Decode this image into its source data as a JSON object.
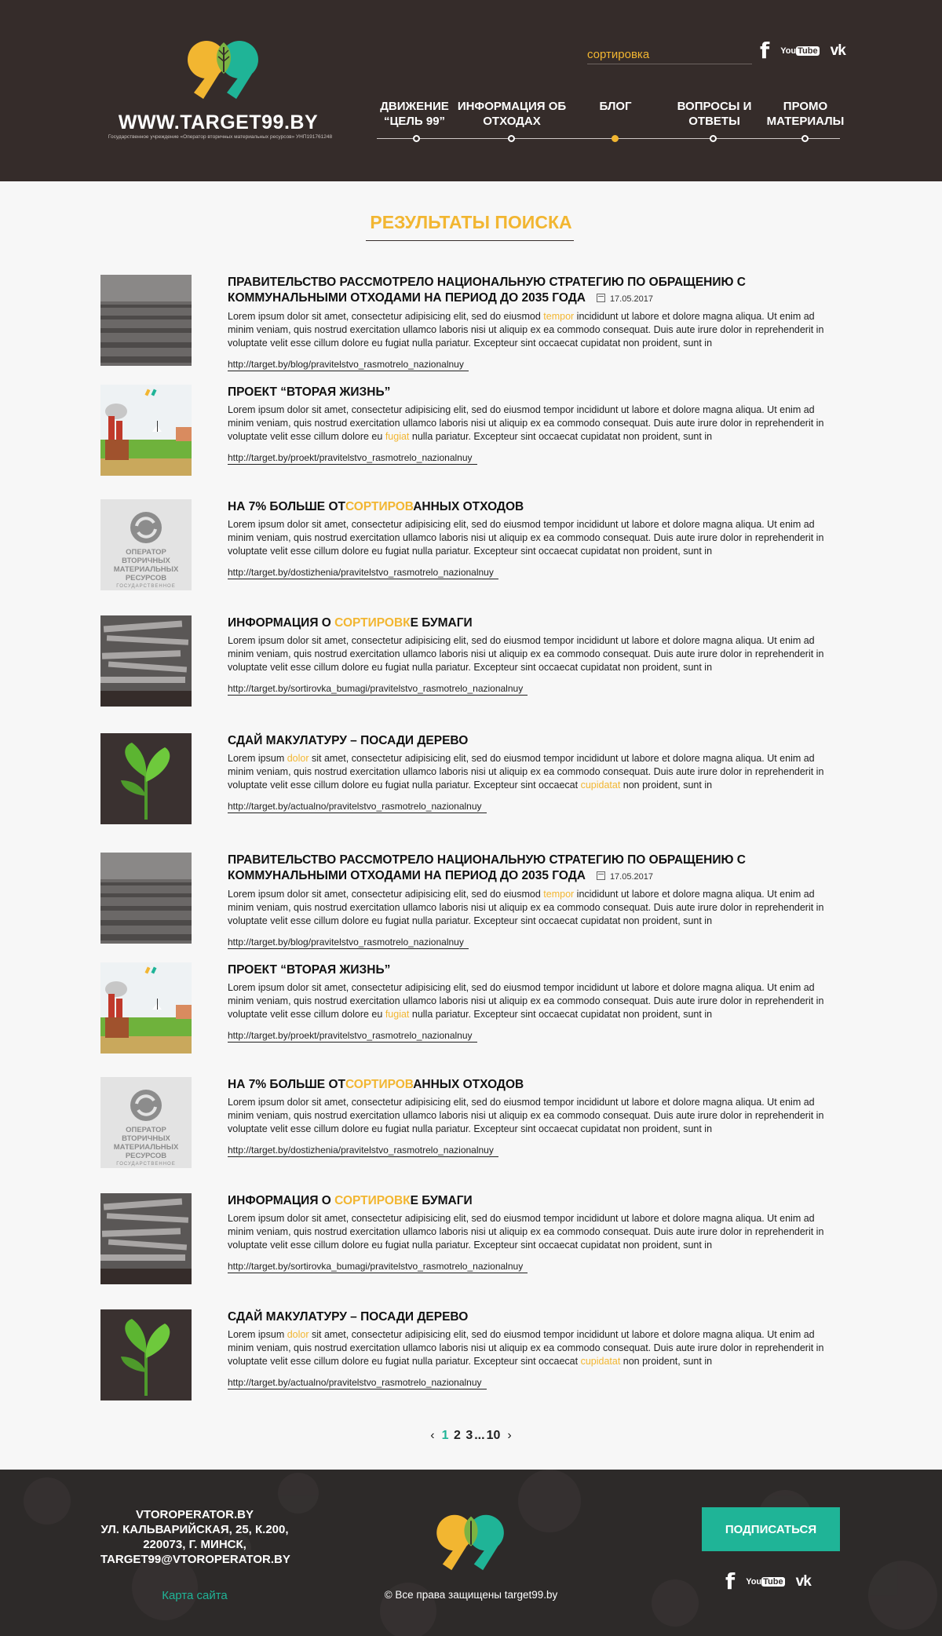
{
  "colors": {
    "header_bg": "#352c2a",
    "accent_yellow": "#f2b631",
    "accent_green": "#1fb497"
  },
  "header": {
    "brand": "WWW.TARGET99.BY",
    "brand_sub": "Государственное учреждение «Оператор вторичных материальных ресурсов» УНП191761248",
    "search_placeholder": "сортировка",
    "social": [
      "facebook-icon",
      "youtube-icon",
      "vk-icon"
    ],
    "youtube_top": "You",
    "youtube_bottom": "Tube",
    "vk": "vk",
    "facebook": "f",
    "nav": [
      {
        "line1": "ДВИЖЕНИЕ",
        "line2": "“ЦЕЛЬ 99”"
      },
      {
        "line1": "ИНФОРМАЦИЯ ОБ",
        "line2": "ОТХОДАХ"
      },
      {
        "line1": "БЛОГ",
        "line2": ""
      },
      {
        "line1": "ВОПРОСЫ И",
        "line2": "ОТВЕТЫ"
      },
      {
        "line1": "ПРОМО",
        "line2": "МАТЕРИАЛЫ"
      }
    ],
    "nav_active": 2
  },
  "main": {
    "title": "РЕЗУЛЬТАТЫ ПОИСКА",
    "results": [
      {
        "thumb": "field",
        "title_pre": "ПРАВИТЕЛЬСТВО РАССМОТРЕЛО НАЦИОНАЛЬНУЮ СТРАТЕГИЮ ПО ОБРАЩЕНИЮ С КОММУНАЛЬНЫМИ ОТХОДАМИ НА ПЕРИОД  ДО 2035 ГОДА",
        "title_hl": "",
        "title_post": "",
        "date": "17.05.2017",
        "text_a": "Lorem ipsum dolor sit amet, consectetur adipisicing elit, sed do eiusmod ",
        "text_hl": "tempor",
        "text_b": " incididunt ut labore et dolore magna aliqua. Ut enim ad minim veniam, quis nostrud exercitation ullamco laboris nisi ut aliquip ex ea commodo consequat. Duis aute irure dolor in reprehenderit in voluptate velit esse cillum dolore eu fugiat nulla pariatur. Excepteur sint occaecat cupidatat non proident, sunt in",
        "text_hl2": "",
        "text_c": "",
        "url": "http://target.by/blog/pravitelstvo_rasmotrelo_nazionalnuy"
      },
      {
        "thumb": "factory",
        "title_pre": "ПРОЕКТ “ВТОРАЯ ЖИЗНЬ”",
        "title_hl": "",
        "title_post": "",
        "date": "",
        "text_a": "Lorem ipsum dolor sit amet, consectetur adipisicing elit, sed do eiusmod tempor incididunt ut labore et dolore magna aliqua. Ut enim ad minim veniam, quis nostrud exercitation ullamco laboris nisi ut aliquip ex ea commodo consequat. Duis aute irure dolor in reprehenderit in voluptate velit esse cillum dolore eu ",
        "text_hl": "fugiat",
        "text_b": " nulla pariatur. Excepteur sint occaecat cupidatat non proident, sunt in",
        "text_hl2": "",
        "text_c": "",
        "url": "http://target.by/proekt/pravitelstvo_rasmotrelo_nazionalnuy"
      },
      {
        "thumb": "operator",
        "title_pre": "НА 7% БОЛЬШЕ ОТ",
        "title_hl": "СОРТИРОВ",
        "title_post": "АННЫХ ОТХОДОВ",
        "date": "",
        "text_a": "Lorem ipsum dolor sit amet, consectetur adipisicing elit, sed do eiusmod tempor incididunt ut labore et dolore magna aliqua. Ut enim ad minim veniam, quis nostrud exercitation ullamco laboris nisi ut aliquip ex ea commodo consequat. Duis aute irure dolor in reprehenderit in voluptate velit esse cillum dolore eu fugiat nulla pariatur. Excepteur sint occaecat cupidatat non proident, sunt in",
        "text_hl": "",
        "text_b": "",
        "text_hl2": "",
        "text_c": "",
        "url": "http://target.by/dostizhenia/pravitelstvo_rasmotrelo_nazionalnuy"
      },
      {
        "thumb": "paper",
        "title_pre": "ИНФОРМАЦИЯ О ",
        "title_hl": "СОРТИРОВК",
        "title_post": "Е БУМАГИ",
        "date": "",
        "text_a": "Lorem ipsum dolor sit amet, consectetur adipisicing elit, sed do eiusmod tempor incididunt ut labore et dolore magna aliqua. Ut enim ad minim veniam, quis nostrud exercitation ullamco laboris nisi ut aliquip ex ea commodo consequat. Duis aute irure dolor in reprehenderit in voluptate velit esse cillum dolore eu fugiat nulla pariatur. Excepteur sint occaecat cupidatat non proident, sunt in",
        "text_hl": "",
        "text_b": "",
        "text_hl2": "",
        "text_c": "",
        "url": "http://target.by/sortirovka_bumagi/pravitelstvo_rasmotrelo_nazionalnuy"
      },
      {
        "thumb": "sprout",
        "title_pre": "СДАЙ МАКУЛАТУРУ – ПОСАДИ ДЕРЕВО",
        "title_hl": "",
        "title_post": "",
        "date": "",
        "text_a": "Lorem ipsum ",
        "text_hl": "dolor",
        "text_b": " sit amet, consectetur adipisicing elit, sed do eiusmod tempor incididunt ut labore et dolore magna aliqua. Ut enim ad minim veniam, quis nostrud exercitation ullamco laboris nisi ut aliquip ex ea commodo consequat. Duis aute irure dolor in reprehenderit in voluptate velit esse cillum dolore eu fugiat nulla pariatur. Excepteur sint occaecat ",
        "text_hl2": "cupidatat",
        "text_c": " non proident, sunt in",
        "url": "http://target.by/actualno/pravitelstvo_rasmotrelo_nazionalnuy"
      },
      {
        "thumb": "field",
        "title_pre": "ПРАВИТЕЛЬСТВО РАССМОТРЕЛО НАЦИОНАЛЬНУЮ СТРАТЕГИЮ ПО ОБРАЩЕНИЮ С КОММУНАЛЬНЫМИ ОТХОДАМИ НА ПЕРИОД  ДО 2035 ГОДА",
        "title_hl": "",
        "title_post": "",
        "date": "17.05.2017",
        "text_a": "Lorem ipsum dolor sit amet, consectetur adipisicing elit, sed do eiusmod ",
        "text_hl": "tempor",
        "text_b": " incididunt ut labore et dolore magna aliqua. Ut enim ad minim veniam, quis nostrud exercitation ullamco laboris nisi ut aliquip ex ea commodo consequat. Duis aute irure dolor in reprehenderit in voluptate velit esse cillum dolore eu fugiat nulla pariatur. Excepteur sint occaecat cupidatat non proident, sunt in",
        "text_hl2": "",
        "text_c": "",
        "url": "http://target.by/blog/pravitelstvo_rasmotrelo_nazionalnuy"
      },
      {
        "thumb": "factory",
        "title_pre": "ПРОЕКТ “ВТОРАЯ ЖИЗНЬ”",
        "title_hl": "",
        "title_post": "",
        "date": "",
        "text_a": "Lorem ipsum dolor sit amet, consectetur adipisicing elit, sed do eiusmod tempor incididunt ut labore et dolore magna aliqua. Ut enim ad minim veniam, quis nostrud exercitation ullamco laboris nisi ut aliquip ex ea commodo consequat. Duis aute irure dolor in reprehenderit in voluptate velit esse cillum dolore eu ",
        "text_hl": "fugiat",
        "text_b": " nulla pariatur. Excepteur sint occaecat cupidatat non proident, sunt in",
        "text_hl2": "",
        "text_c": "",
        "url": "http://target.by/proekt/pravitelstvo_rasmotrelo_nazionalnuy"
      },
      {
        "thumb": "operator",
        "title_pre": "НА 7% БОЛЬШЕ ОТ",
        "title_hl": "СОРТИРОВ",
        "title_post": "АННЫХ ОТХОДОВ",
        "date": "",
        "text_a": "Lorem ipsum dolor sit amet, consectetur adipisicing elit, sed do eiusmod tempor incididunt ut labore et dolore magna aliqua. Ut enim ad minim veniam, quis nostrud exercitation ullamco laboris nisi ut aliquip ex ea commodo consequat. Duis aute irure dolor in reprehenderit in voluptate velit esse cillum dolore eu fugiat nulla pariatur. Excepteur sint occaecat cupidatat non proident, sunt in",
        "text_hl": "",
        "text_b": "",
        "text_hl2": "",
        "text_c": "",
        "url": "http://target.by/dostizhenia/pravitelstvo_rasmotrelo_nazionalnuy"
      },
      {
        "thumb": "paper",
        "title_pre": "ИНФОРМАЦИЯ О ",
        "title_hl": "СОРТИРОВК",
        "title_post": "Е БУМАГИ",
        "date": "",
        "text_a": "Lorem ipsum dolor sit amet, consectetur adipisicing elit, sed do eiusmod tempor incididunt ut labore et dolore magna aliqua. Ut enim ad minim veniam, quis nostrud exercitation ullamco laboris nisi ut aliquip ex ea commodo consequat. Duis aute irure dolor in reprehenderit in voluptate velit esse cillum dolore eu fugiat nulla pariatur. Excepteur sint occaecat cupidatat non proident, sunt in",
        "text_hl": "",
        "text_b": "",
        "text_hl2": "",
        "text_c": "",
        "url": "http://target.by/sortirovka_bumagi/pravitelstvo_rasmotrelo_nazionalnuy"
      },
      {
        "thumb": "sprout",
        "title_pre": "СДАЙ МАКУЛАТУРУ – ПОСАДИ ДЕРЕВО",
        "title_hl": "",
        "title_post": "",
        "date": "",
        "text_a": "Lorem ipsum ",
        "text_hl": "dolor",
        "text_b": " sit amet, consectetur adipisicing elit, sed do eiusmod tempor incididunt ut labore et dolore magna aliqua. Ut enim ad minim veniam, quis nostrud exercitation ullamco laboris nisi ut aliquip ex ea commodo consequat. Duis aute irure dolor in reprehenderit in voluptate velit esse cillum dolore eu fugiat nulla pariatur. Excepteur sint occaecat ",
        "text_hl2": "cupidatat",
        "text_c": " non proident, sunt in",
        "url": "http://target.by/actualno/pravitelstvo_rasmotrelo_nazionalnuy"
      }
    ],
    "operator_thumb": {
      "line1": "ОПЕРАТОР ВТОРИЧНЫХ",
      "line2": "МАТЕРИАЛЬНЫХ РЕСУРСОВ",
      "line3": "ГОСУДАРСТВЕННОЕ УЧРЕЖДЕНИЕ"
    }
  },
  "pagination": {
    "pages": [
      "1",
      "2",
      "3"
    ],
    "ellipsis": "...",
    "last": "10",
    "current": "1",
    "prev": "‹",
    "next": "›"
  },
  "footer": {
    "address_lines": [
      "VTOROPERATOR.BY",
      "УЛ. КАЛЬВАРИЙСКАЯ, 25, К.200,",
      "220073, Г. МИНСК,",
      "TARGET99@VTOROPERATOR.BY"
    ],
    "sitemap": "Карта сайта",
    "copyright": "© Все права защищены target99.by",
    "subscribe": "ПОДПИСАТЬСЯ"
  }
}
